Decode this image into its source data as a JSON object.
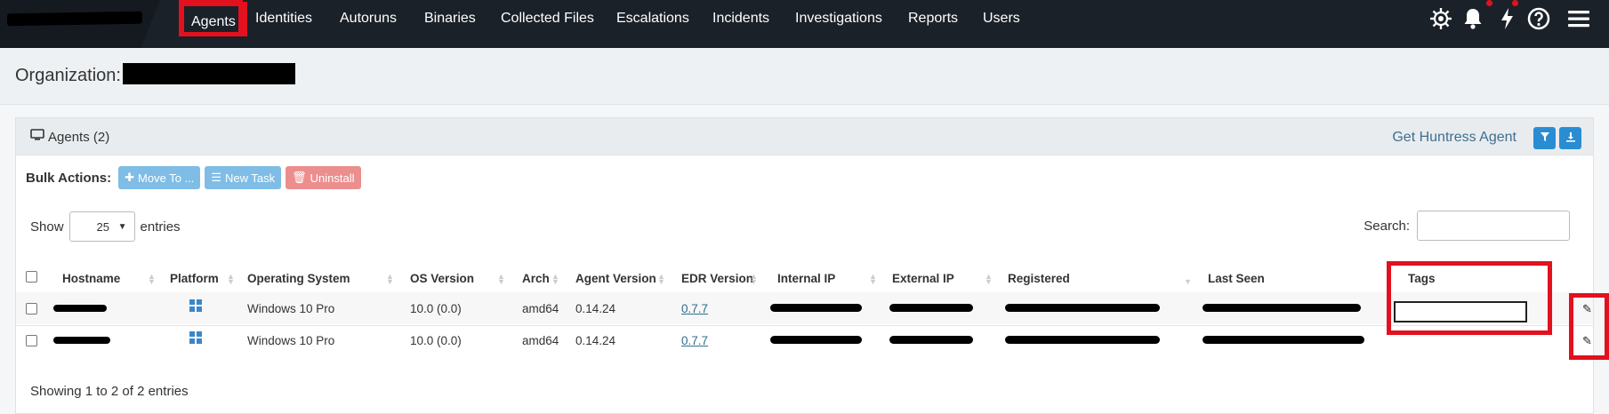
{
  "nav": {
    "items": [
      "Agents",
      "Identities",
      "Autoruns",
      "Binaries",
      "Collected Files",
      "Escalations",
      "Incidents",
      "Investigations",
      "Reports",
      "Users"
    ],
    "active": "Agents"
  },
  "org": {
    "label": "Organization:"
  },
  "panel": {
    "title": "Agents (2)",
    "get_agent": "Get Huntress Agent"
  },
  "bulk": {
    "label": "Bulk Actions:",
    "move_to": "Move To ...",
    "new_task": "New Task",
    "uninstall": "Uninstall"
  },
  "length": {
    "show": "Show",
    "value": "25",
    "entries": "entries"
  },
  "search": {
    "label": "Search:"
  },
  "table": {
    "columns": [
      "Hostname",
      "Platform",
      "Operating System",
      "OS Version",
      "Arch",
      "Agent Version",
      "EDR Version",
      "Internal IP",
      "External IP",
      "Registered",
      "Last Seen",
      "Tags"
    ],
    "rows": [
      {
        "os": "Windows 10 Pro",
        "os_version": "10.0 (0.0)",
        "arch": "amd64",
        "agent_version": "0.14.24",
        "edr_version": "0.7.7"
      },
      {
        "os": "Windows 10 Pro",
        "os_version": "10.0 (0.0)",
        "arch": "amd64",
        "agent_version": "0.14.24",
        "edr_version": "0.7.7"
      }
    ]
  },
  "footer": {
    "info": "Showing 1 to 2 of 2 entries"
  },
  "icons": [
    "settings-icon",
    "bell-icon",
    "bolt-icon",
    "help-icon",
    "menu-icon",
    "monitor-icon",
    "filter-icon",
    "download-icon",
    "windows-icon",
    "pencil-icon"
  ],
  "colors": {
    "nav_bg": "#1b2129",
    "highlight": "#e3101e",
    "primary": "#2a8dd4",
    "link": "#2d6f8f"
  }
}
